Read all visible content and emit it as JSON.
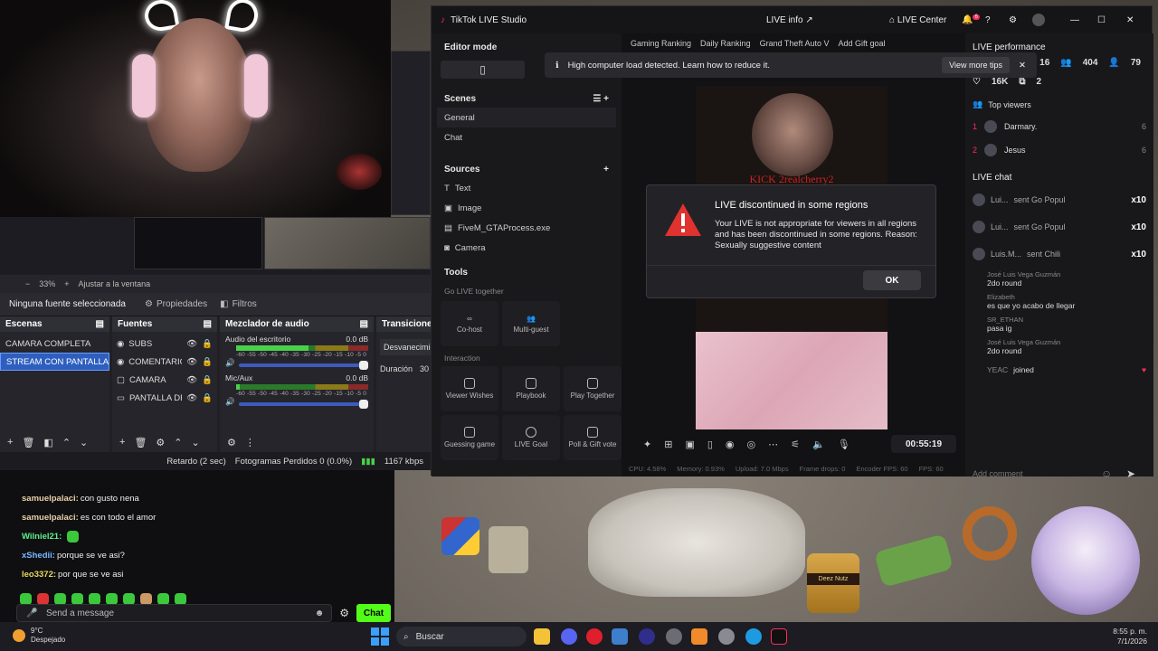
{
  "obs": {
    "zoom": "33%",
    "fit_window": "Ajustar a la ventana",
    "no_source": "Ninguna fuente seleccionada",
    "properties": "Propiedades",
    "filters": "Filtros",
    "scenes_title": "Escenas",
    "scenes": [
      "CAMARA COMPLETA",
      "STREAM CON PANTALLA M"
    ],
    "sources_title": "Fuentes",
    "sources": [
      "SUBS",
      "COMENTARIC",
      "CAMARA",
      "PANTALLA DE"
    ],
    "mixer_title": "Mezclador de audio",
    "mixer": [
      {
        "name": "Audio del escritorio",
        "db": "0.0 dB"
      },
      {
        "name": "Mic/Aux",
        "db": "0.0 dB"
      }
    ],
    "meter_ticks": "-60 -55 -50 -45 -40 -35 -30 -25 -20 -15 -10 -5 0",
    "transitions_title": "Transiciones",
    "transition": "Desvanecimiento",
    "duration_label": "Duración",
    "duration_value": "30",
    "status_delay": "Retardo (2 sec)",
    "status_frames": "Fotogramas Perdidos 0 (0.0%)",
    "status_bitrate": "1167 kbps"
  },
  "chat": {
    "lines": [
      {
        "user": "samuelpalaci:",
        "text": "con gusto nena",
        "color": "#e8d0a8"
      },
      {
        "user": "samuelpalaci:",
        "text": "es con todo el amor",
        "color": "#e8d0a8"
      },
      {
        "user": "Wilniel21:",
        "text": "",
        "color": "#5cf08c"
      },
      {
        "user": "xShedii:",
        "text": "porque se ve asi?",
        "color": "#7ab8ff"
      },
      {
        "user": "leo3372:",
        "text": "por que se ve asi",
        "color": "#e8d85a"
      }
    ],
    "placeholder": "Send a message",
    "send": "Chat"
  },
  "tts": {
    "app_title": "TikTok LIVE Studio",
    "live_info": "LIVE info",
    "live_center": "LIVE Center",
    "notif_count": "6",
    "editor_mode": "Editor mode",
    "scenes_title": "Scenes",
    "scenes": [
      "General",
      "Chat"
    ],
    "sources_title": "Sources",
    "sources": [
      "Text",
      "Image",
      "FiveM_GTAProcess.exe",
      "Camera"
    ],
    "tools_title": "Tools",
    "go_live_together": "Go LIVE together",
    "cohost": "Co-host",
    "multiguest": "Multi-guest",
    "interaction": "Interaction",
    "tools": [
      "Viewer Wishes",
      "Playbook",
      "Play Together",
      "Guessing game",
      "LIVE Goal",
      "Poll & Gift vote"
    ],
    "chips": [
      "Gaming Ranking",
      "Daily Ranking",
      "Grand Theft Auto V",
      "Add Gift goal"
    ],
    "timer": "00:55:19",
    "stats": [
      "CPU: 4.58%",
      "Memory: 0.93%",
      "Upload: 7.0 Mbps",
      "Frame drops: 0",
      "Encoder FPS: 60",
      "FPS: 60"
    ],
    "performance_title": "LIVE performance",
    "perf": [
      "16",
      "404",
      "79"
    ],
    "likes": "16K",
    "shares": "2",
    "top_viewers_title": "Top viewers",
    "top_viewers": [
      {
        "rank": "1",
        "name": "Darmary.",
        "score": "6"
      },
      {
        "rank": "2",
        "name": "Jesus",
        "score": "6"
      }
    ],
    "live_chat_title": "LIVE chat",
    "gifts": [
      {
        "user": "Lui...",
        "text": "sent Go Popul",
        "count": "x10"
      },
      {
        "user": "Lui...",
        "text": "sent Go Popul",
        "count": "x10"
      },
      {
        "user": "Luis.M...",
        "text": "sent Chili",
        "count": "x10"
      }
    ],
    "comments": [
      {
        "name": "José Luis Vega Guzmán",
        "text": "2do round"
      },
      {
        "name": "Elizabeth",
        "text": "es que yo acabo de llegar"
      },
      {
        "name": "SR_ETHAN",
        "text": "pasa ig"
      },
      {
        "name": "José Luis Vega Guzmán",
        "text": "2do round"
      }
    ],
    "joined_user": "YEAC",
    "joined_text": "joined",
    "add_comment": "Add comment",
    "preview_overlay": "KICK 2realcherry2"
  },
  "toast": {
    "text": "High computer load detected. Learn how to reduce it.",
    "more": "View more tips"
  },
  "modal": {
    "title": "LIVE discontinued in some regions",
    "body": "Your LIVE is not appropriate for viewers in all regions and has been discontinued in some regions. Reason: Sexually suggestive content",
    "ok": "OK"
  },
  "taskbar": {
    "temp": "9°C",
    "weather": "Despejado",
    "search": "Buscar",
    "time": "8:55 p. m.",
    "date": "7/1/2026"
  },
  "wallpaper": {
    "jar_label": "Deez Nutz"
  },
  "colors": {
    "obs_blue": "#2e5fbf",
    "kick_green": "#53fc18",
    "tiktok_red": "#fe2c55",
    "modal_red": "#e0322e"
  }
}
